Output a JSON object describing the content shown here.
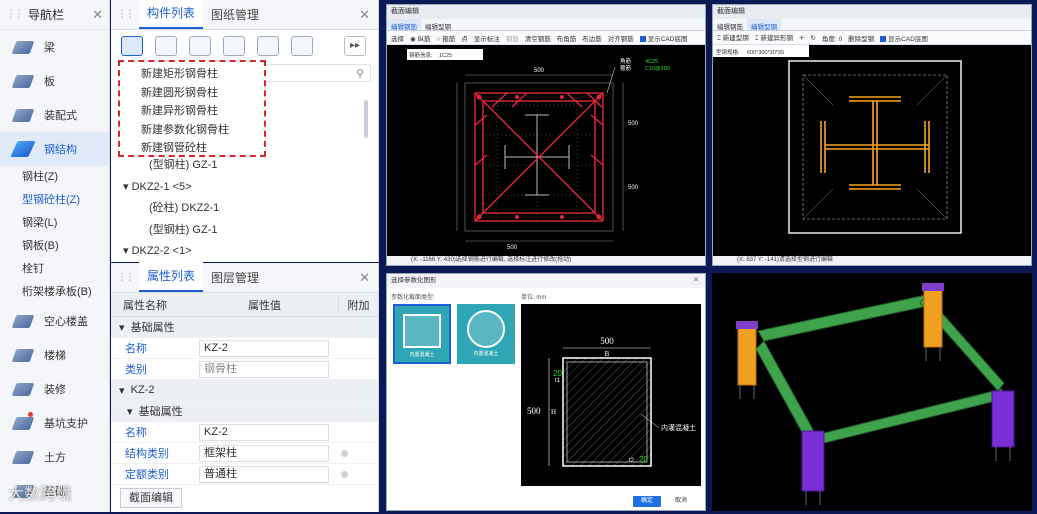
{
  "nav": {
    "title": "导航栏",
    "items": [
      {
        "label": "梁"
      },
      {
        "label": "板"
      },
      {
        "label": "装配式"
      },
      {
        "label": "钢结构"
      }
    ],
    "sub_items": [
      "钢柱(Z)",
      "型钢砼柱(Z)",
      "钢梁(L)",
      "钢板(B)",
      "栓钉",
      "桁架楼承板(B)"
    ],
    "items2": [
      {
        "label": "空心楼盖"
      },
      {
        "label": "楼梯"
      },
      {
        "label": "装修"
      },
      {
        "label": "基坑支护"
      },
      {
        "label": "土方"
      },
      {
        "label": "基础"
      }
    ]
  },
  "component_panel": {
    "tabs": [
      "构件列表",
      "图纸管理"
    ],
    "new_menu": [
      "新建矩形钢骨柱",
      "新建圆形钢骨柱",
      "新建异形钢骨柱",
      "新建参数化钢骨柱",
      "新建钢管砼柱"
    ],
    "tree": [
      {
        "label": "(型钢柱) GZ-1",
        "level": 1
      },
      {
        "label": "DKZ2-1 <5>",
        "level": 0
      },
      {
        "label": "(砼柱) DKZ2-1",
        "level": 1
      },
      {
        "label": "(型钢柱) GZ-1",
        "level": 1
      },
      {
        "label": "DKZ2-2 <1>",
        "level": 0
      }
    ]
  },
  "property_panel": {
    "tabs": [
      "属性列表",
      "图层管理"
    ],
    "headers": [
      "属性名称",
      "属性值",
      "附加"
    ],
    "rows": [
      {
        "type": "group",
        "label": "基础属性"
      },
      {
        "type": "row",
        "key": "名称",
        "value": "KZ-2"
      },
      {
        "type": "row",
        "key": "类别",
        "value": "钢骨柱",
        "muted": true
      },
      {
        "type": "group",
        "label": "KZ-2"
      },
      {
        "type": "group",
        "label": "基础属性"
      },
      {
        "type": "row",
        "key": "名称",
        "value": "KZ-2"
      },
      {
        "type": "row",
        "key": "结构类别",
        "value": "框架柱",
        "dot": true
      },
      {
        "type": "row",
        "key": "定额类别",
        "value": "普通柱",
        "dot": true
      }
    ],
    "bottom_tab": "截面编辑"
  },
  "watermark": "大数跨境",
  "editor1": {
    "title": "截面编辑",
    "tabs": [
      "编辑钢筋",
      "编辑型钢"
    ],
    "tools": [
      "选择",
      "纵筋",
      "箍筋",
      "点",
      "显示标注",
      "钢筋",
      "清空钢筋",
      "布角筋",
      "布边筋",
      "对齐钢筋",
      "显示CAD底图"
    ],
    "rebar_label": "钢筋信息:",
    "rebar_value": "1C25",
    "dims": {
      "top": "500",
      "side1": "500",
      "side2": "500",
      "bottom": "500"
    },
    "legend": [
      "角筋",
      "箍筋",
      "4C25",
      "C10@200"
    ],
    "status": "(X: -1166 Y: 430)选择钢筋进行编辑, 选择标注进行修改(拖动)"
  },
  "editor2": {
    "title": "截面编辑",
    "tabs": [
      "编辑钢筋",
      "编辑型钢"
    ],
    "tools": [
      "新建型钢",
      "新建异形钢",
      "角度:",
      "0",
      "删除型钢",
      "显示CAD底图"
    ],
    "size_label": "型钢规格:",
    "size_value": "600*300*30*30",
    "status": "(X: 837 Y: -141)请选择型钢进行编辑"
  },
  "dialog": {
    "title": "选择参数化图形",
    "section_label": "参数化截面类型:",
    "unit_label": "单位: mm",
    "shapes": [
      "内置混凝土",
      "内置混凝土"
    ],
    "dims": {
      "top": "500",
      "b": "B",
      "h": "H",
      "side": "500",
      "t1v": "20",
      "t1": "t1",
      "t2": "t2",
      "t2v": "20"
    },
    "note": "内灌混凝土",
    "ok": "确定",
    "cancel": "取消"
  }
}
